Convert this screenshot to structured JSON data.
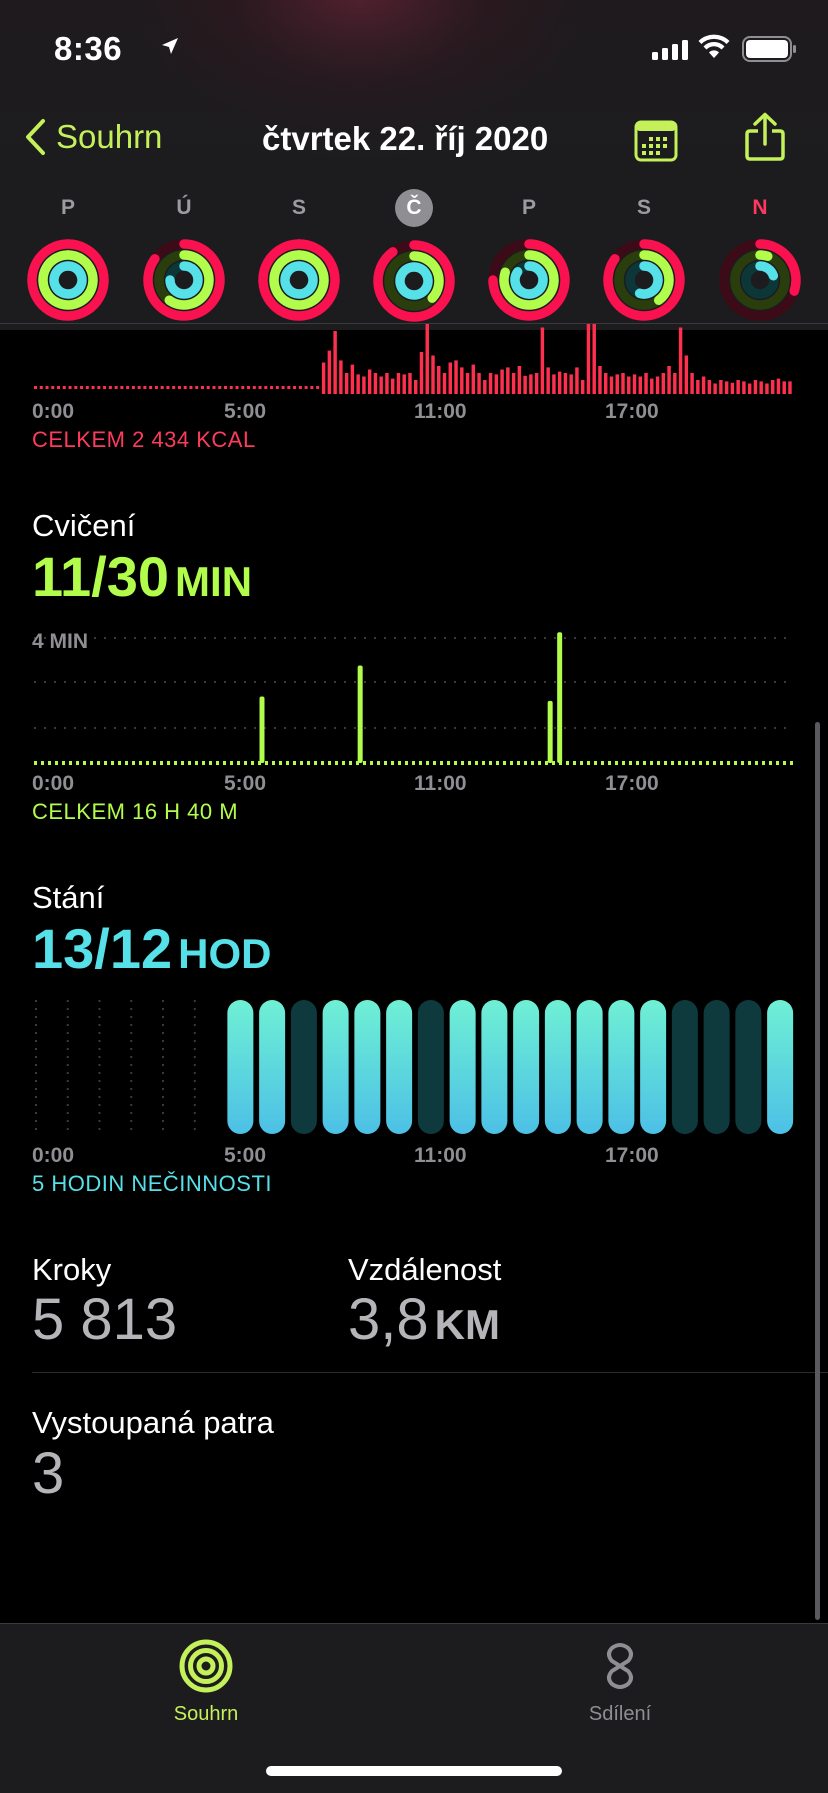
{
  "status": {
    "time": "8:36"
  },
  "nav": {
    "back_label": "Souhrn",
    "title": "čtvrtek 22. říj 2020"
  },
  "week": [
    {
      "letter": "P",
      "move": 1.0,
      "exercise": 1.0,
      "stand": 1.0,
      "selected": false,
      "today": false
    },
    {
      "letter": "Ú",
      "move": 0.85,
      "exercise": 0.6,
      "stand": 0.75,
      "selected": false,
      "today": false
    },
    {
      "letter": "S",
      "move": 1.0,
      "exercise": 1.0,
      "stand": 1.0,
      "selected": false,
      "today": false
    },
    {
      "letter": "Č",
      "move": 0.9,
      "exercise": 0.37,
      "stand": 1.0,
      "selected": true,
      "today": false
    },
    {
      "letter": "P",
      "move": 0.75,
      "exercise": 0.8,
      "stand": 0.85,
      "selected": false,
      "today": false
    },
    {
      "letter": "S",
      "move": 0.85,
      "exercise": 0.4,
      "stand": 0.55,
      "selected": false,
      "today": false
    },
    {
      "letter": "N",
      "move": 0.3,
      "exercise": 0.05,
      "stand": 0.2,
      "selected": false,
      "today": true
    }
  ],
  "time_ticks": [
    "0:00",
    "5:00",
    "11:00",
    "17:00"
  ],
  "move": {
    "total": "CELKEM 2 434 KCAL",
    "bars": [
      0.04,
      0.04,
      0.04,
      0.04,
      0.04,
      0.04,
      0.04,
      0.04,
      0.04,
      0.04,
      0.04,
      0.04,
      0.04,
      0.04,
      0.04,
      0.04,
      0.04,
      0.04,
      0.04,
      0.04,
      0.04,
      0.04,
      0.04,
      0.04,
      0.04,
      0.04,
      0.04,
      0.04,
      0.04,
      0.04,
      0.04,
      0.04,
      0.04,
      0.04,
      0.04,
      0.04,
      0.04,
      0.04,
      0.04,
      0.04,
      0.04,
      0.04,
      0.04,
      0.04,
      0.04,
      0.04,
      0.04,
      0.04,
      0.04,
      0.04,
      0.04,
      0.04,
      0.04,
      0.04,
      0.04,
      0.04,
      0.04,
      0.04,
      0.04,
      0.04,
      0.04,
      0.04,
      0.04,
      0.04,
      0.04,
      0.04,
      0.04,
      0.04,
      0.04,
      0.04,
      0.04,
      0.04,
      0.04,
      0.04,
      0.04,
      0.04,
      0.04,
      0.04,
      0.04,
      0.04,
      0.04,
      0.04,
      0.04,
      0.04,
      0.04,
      0.04,
      0.04,
      0.04,
      0.04,
      0.04,
      0.04,
      0.04,
      0.04,
      0.04,
      0.04,
      0.04,
      0.04,
      0.04,
      0.04,
      0.04,
      0.04,
      0.04,
      0.04,
      0.04,
      0.04,
      0.04,
      0.04,
      0.04,
      0.04,
      0.04,
      0.04,
      0.04,
      0.04,
      0.04,
      0.04,
      0.04,
      0.04,
      0.04,
      0.04,
      0.04,
      0.04,
      0.04,
      0.04,
      0.04,
      0.04,
      0.04,
      0.04,
      0.04,
      0.04,
      0.04,
      0.04,
      0.04,
      0.04,
      0.04,
      0.04,
      0.04,
      0.04,
      0.04,
      0.04,
      0.04,
      0.04,
      0.04,
      0.04,
      0.04,
      0.04,
      0.04,
      0.04,
      0.04,
      0.04,
      0.04,
      0.04,
      0.04,
      0.04,
      0.04,
      0.04,
      0.04,
      0.04,
      0.04,
      0.04,
      0.04,
      0.04,
      0.04,
      0.04,
      0.04,
      0.04,
      0.04,
      0.04,
      0.04,
      0.04,
      0.04,
      0.04,
      0.04,
      0.04,
      0.04,
      0.04,
      0.04,
      0.04,
      0.04,
      0.04,
      0.04,
      0.04,
      0.04,
      0.04,
      0.04,
      0.04,
      0.04,
      0.04,
      0.04,
      0.04,
      0.04,
      0.04,
      0.04,
      0.04,
      0.04,
      0.04,
      0.04,
      0.04,
      0.04,
      0.04,
      0.04,
      0.04,
      0.04,
      0.04,
      0.04,
      0.04,
      0.04,
      0.04,
      0.04,
      0.04,
      0.04,
      0.04,
      0.04,
      0.04,
      0.04,
      0.04,
      0.04,
      0.04,
      0.04,
      0.04,
      0.04,
      0.04,
      0.04,
      0.04,
      0.04,
      0.04,
      0.04,
      0.04,
      0.04,
      0.04,
      0.04,
      0.04,
      0.04,
      0.04,
      0.04,
      0.04,
      0.04,
      0.04,
      0.04,
      0.04,
      0.04,
      0.04,
      0.04,
      0.04,
      0.04,
      0.04,
      0.04,
      0.04,
      0.04,
      0.04,
      0.04,
      0.04,
      0.04,
      0.04,
      0.04,
      0.04,
      0.04,
      0.04,
      0.04,
      0.04,
      0.04,
      0.04,
      0.04,
      0.04,
      0.04,
      0.04,
      0.04,
      0.04,
      0.04,
      0.04,
      0.04,
      0.04,
      0.04,
      0.04,
      0.04,
      0.04,
      0.04,
      0.04,
      0.04,
      0.04,
      0.04,
      0.04,
      0.04,
      0.04,
      0.04,
      0.04,
      0.04,
      0.04,
      0.04,
      0.04,
      0.04,
      0.04,
      0.04,
      0.04
    ]
  },
  "move_hourly": [
    0.08,
    0.08,
    0.08,
    0.08,
    0.08,
    0.08,
    0.08,
    0.08,
    0.08,
    0.08,
    0.08,
    0.08,
    0.08,
    0.08,
    0.08,
    0.08,
    0.08,
    0.08,
    0.08,
    0.08,
    0.08,
    0.08,
    0.08,
    0.08,
    0.08,
    0.08,
    0.08,
    0.08,
    0.08,
    0.08,
    0.08,
    0.08,
    0.08,
    0.08,
    0.08,
    0.08,
    0.08,
    0.08,
    0.08,
    0.08,
    0.08,
    0.08,
    0.08,
    0.08,
    0.08,
    0.08,
    0.08,
    0.08,
    0.08,
    0.08,
    0.45,
    0.62,
    0.9,
    0.48,
    0.3,
    0.42,
    0.28,
    0.25,
    0.35,
    0.3,
    0.25,
    0.3,
    0.22,
    0.3,
    0.28,
    0.3,
    0.2,
    0.6,
    1.0,
    0.55,
    0.4,
    0.3,
    0.45,
    0.48,
    0.38,
    0.3,
    0.42,
    0.3,
    0.2,
    0.3,
    0.28,
    0.35,
    0.38,
    0.3,
    0.4,
    0.26,
    0.28,
    0.3,
    0.95,
    0.38,
    0.28,
    0.32,
    0.3,
    0.28,
    0.38,
    0.2,
    1.0,
    1.0,
    0.4,
    0.3,
    0.25,
    0.28,
    0.3,
    0.25,
    0.28,
    0.25,
    0.3,
    0.22,
    0.25,
    0.3,
    0.4,
    0.3,
    0.95,
    0.55,
    0.3,
    0.2,
    0.25,
    0.2,
    0.15,
    0.2,
    0.18,
    0.16,
    0.2,
    0.18,
    0.15,
    0.2,
    0.18,
    0.15,
    0.2,
    0.22,
    0.18,
    0.18
  ],
  "exercise": {
    "title": "Cvičení",
    "value": "11/30",
    "unit": "MIN",
    "scale_label": "4 MIN",
    "total": "CELKEM 16 H 40 M",
    "spikes": [
      {
        "hour": 7.2,
        "minutes": 1.5
      },
      {
        "hour": 10.3,
        "minutes": 2.2
      },
      {
        "hour": 16.3,
        "minutes": 1.4
      },
      {
        "hour": 16.6,
        "minutes": 2.95
      }
    ]
  },
  "stand": {
    "title": "Stání",
    "value": "13/12",
    "unit": "HOD",
    "total": "5 HODIN NEČINNOSTI",
    "hours": [
      0,
      0,
      0,
      0,
      0,
      0,
      1,
      1,
      0,
      1,
      1,
      1,
      0,
      1,
      1,
      1,
      1,
      1,
      1,
      1,
      0,
      0,
      0,
      1
    ]
  },
  "steps": {
    "title": "Kroky",
    "value": "5 813"
  },
  "distance": {
    "title": "Vzdálenost",
    "value": "3,8",
    "unit": "KM"
  },
  "floors": {
    "title": "Vystoupaná patra",
    "value": "3"
  },
  "tabs": {
    "summary": "Souhrn",
    "sharing": "Sdílení"
  },
  "colors": {
    "move": "#fa114f",
    "move_bar": "#ff2f4e",
    "exercise": "#b2fc4c",
    "stand": "#56e0e8",
    "accent_green": "#c4f05a"
  }
}
